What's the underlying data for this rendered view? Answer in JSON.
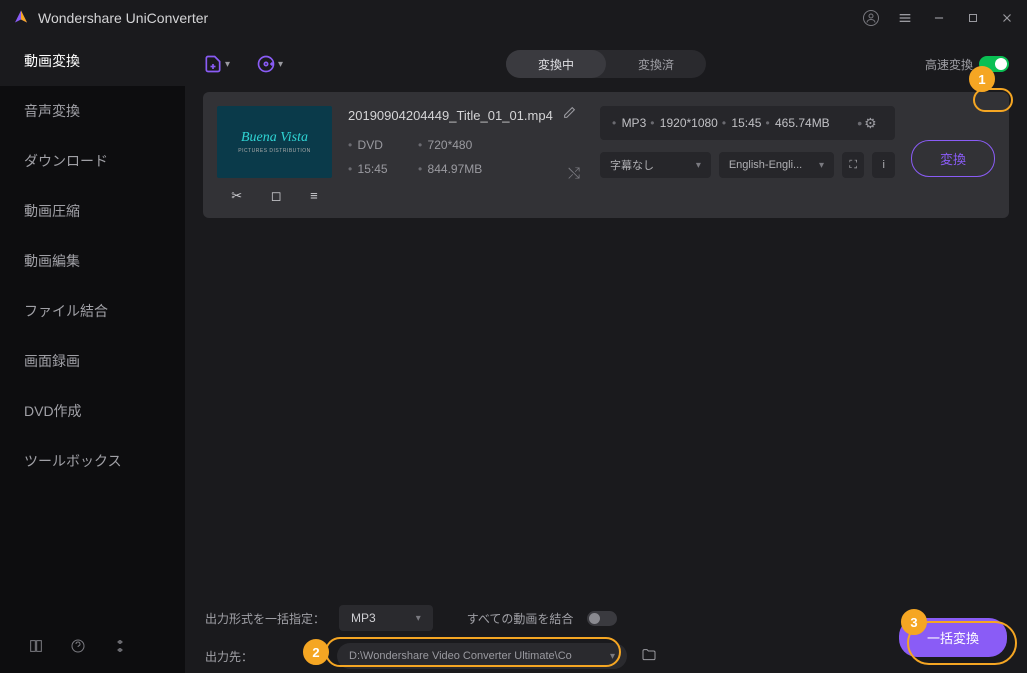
{
  "app_title": "Wondershare UniConverter",
  "sidebar": {
    "items": [
      "動画変換",
      "音声変換",
      "ダウンロード",
      "動画圧縮",
      "動画編集",
      "ファイル結合",
      "画面録画",
      "DVD作成",
      "ツールボックス"
    ],
    "active": 0
  },
  "toolbar": {
    "tabs": {
      "converting": "変換中",
      "converted": "変換済"
    },
    "speed_label": "高速変換"
  },
  "file": {
    "name": "20190904204449_Title_01_01.mp4",
    "thumb_text": "Buena Vista",
    "meta": {
      "a": "DVD",
      "b": "720*480",
      "c": "15:45",
      "d": "844.97MB"
    },
    "out": {
      "fmt": "MP3",
      "res": "1920*1080",
      "dur": "15:45",
      "size": "465.74MB"
    },
    "subtitle": "字幕なし",
    "lang": "English-Engli...",
    "convert": "変換"
  },
  "footer": {
    "format_label": "出力形式を一括指定：",
    "format_value": "MP3",
    "merge_label": "すべての動画を結合",
    "output_label": "出力先：",
    "output_path": "D:\\Wondershare Video Converter Ultimate\\Co",
    "batch": "一括変換"
  },
  "callouts": {
    "c1": "1",
    "c2": "2",
    "c3": "3"
  }
}
